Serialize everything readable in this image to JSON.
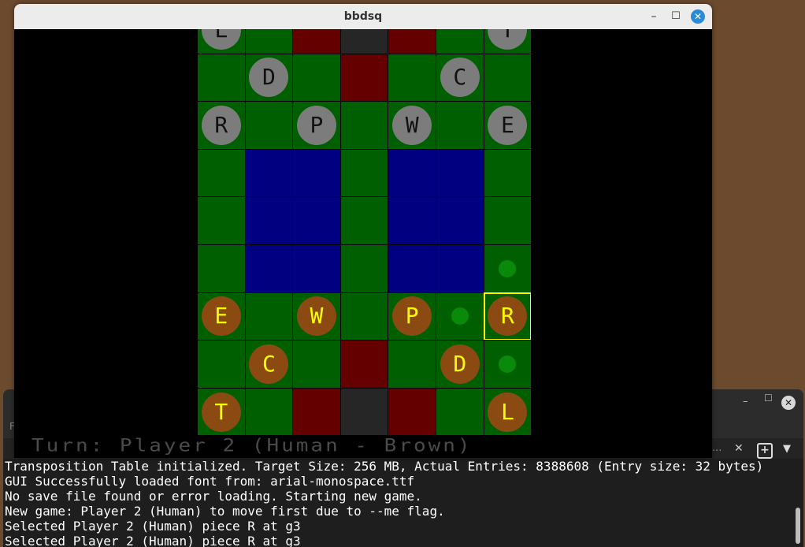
{
  "window": {
    "title": "bbdsq",
    "minimize_label": "–",
    "maximize_label": "☐",
    "close_label": "✕"
  },
  "colors": {
    "green": "#005f00",
    "blue": "#000080",
    "red": "#640000",
    "dark": "#262626",
    "gray_piece": "#7c7c7c",
    "brown_piece": "#8a4a12",
    "brown_text": "#ffff00",
    "move_dot": "#0a8a0a",
    "selection": "#ffff00"
  },
  "board": {
    "rows": [
      [
        "G",
        "G",
        "R",
        "D",
        "R",
        "G",
        "G"
      ],
      [
        "G",
        "G",
        "G",
        "R",
        "G",
        "G",
        "G"
      ],
      [
        "G",
        "G",
        "G",
        "G",
        "G",
        "G",
        "G"
      ],
      [
        "G",
        "B",
        "B",
        "G",
        "B",
        "B",
        "G"
      ],
      [
        "G",
        "B",
        "B",
        "G",
        "B",
        "B",
        "G"
      ],
      [
        "G",
        "B",
        "B",
        "G",
        "B",
        "B",
        "G"
      ],
      [
        "G",
        "G",
        "G",
        "G",
        "G",
        "G",
        "G"
      ],
      [
        "G",
        "G",
        "G",
        "R",
        "G",
        "G",
        "G"
      ],
      [
        "G",
        "G",
        "R",
        "D",
        "R",
        "G",
        "G"
      ]
    ],
    "pieces": [
      {
        "row": 0,
        "col": 0,
        "label": "L",
        "owner": "gray"
      },
      {
        "row": 0,
        "col": 6,
        "label": "T",
        "owner": "gray"
      },
      {
        "row": 1,
        "col": 1,
        "label": "D",
        "owner": "gray"
      },
      {
        "row": 1,
        "col": 5,
        "label": "C",
        "owner": "gray"
      },
      {
        "row": 2,
        "col": 0,
        "label": "R",
        "owner": "gray"
      },
      {
        "row": 2,
        "col": 2,
        "label": "P",
        "owner": "gray"
      },
      {
        "row": 2,
        "col": 4,
        "label": "W",
        "owner": "gray"
      },
      {
        "row": 2,
        "col": 6,
        "label": "E",
        "owner": "gray"
      },
      {
        "row": 6,
        "col": 0,
        "label": "E",
        "owner": "brown"
      },
      {
        "row": 6,
        "col": 2,
        "label": "W",
        "owner": "brown"
      },
      {
        "row": 6,
        "col": 4,
        "label": "P",
        "owner": "brown"
      },
      {
        "row": 6,
        "col": 6,
        "label": "R",
        "owner": "brown"
      },
      {
        "row": 7,
        "col": 1,
        "label": "C",
        "owner": "brown"
      },
      {
        "row": 7,
        "col": 5,
        "label": "D",
        "owner": "brown"
      },
      {
        "row": 8,
        "col": 0,
        "label": "T",
        "owner": "brown"
      },
      {
        "row": 8,
        "col": 6,
        "label": "L",
        "owner": "brown"
      }
    ],
    "move_dots": [
      {
        "row": 5,
        "col": 6
      },
      {
        "row": 6,
        "col": 5
      },
      {
        "row": 7,
        "col": 6
      }
    ],
    "selected": {
      "row": 6,
      "col": 6
    }
  },
  "status_text": "Turn: Player 2 (Human - Brown)",
  "terminal": {
    "tab_left": "F",
    "tab_ellipsis": "...",
    "tab_close": "✕",
    "new_tab": "+",
    "dropdown": "▼",
    "minimize": "–",
    "maximize": "☐",
    "close": "✕",
    "lines": [
      "Transposition Table initialized. Target Size: 256 MB, Actual Entries: 8388608 (Entry size: 32 bytes)",
      "GUI Successfully loaded font from: arial-monospace.ttf",
      "No save file found or error loading. Starting new game.",
      "New game: Player 2 (Human) to move first due to --me flag.",
      "Selected Player 2 (Human) piece R at g3",
      "Selected Player 2 (Human) piece R at g3"
    ]
  }
}
